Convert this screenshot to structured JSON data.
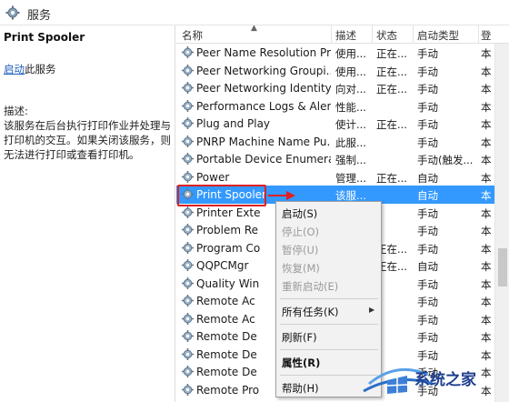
{
  "window": {
    "title": "服务"
  },
  "left": {
    "service_name": "Print Spooler",
    "start_link": "启动",
    "start_rest": "此服务",
    "desc_label": "描述:",
    "desc_text": "该服务在后台执行打印作业并处理与打印机的交互。如果关闭该服务，则无法进行打印或查看打印机。"
  },
  "columns": {
    "name": "名称",
    "desc": "描述",
    "status": "状态",
    "start": "启动类型",
    "logon": "登"
  },
  "services": [
    {
      "name": "Peer Name Resolution Pr...",
      "desc": "使用...",
      "status": "正在...",
      "start": "手动",
      "logon": "本"
    },
    {
      "name": "Peer Networking Groupi...",
      "desc": "使用...",
      "status": "正在...",
      "start": "手动",
      "logon": "本"
    },
    {
      "name": "Peer Networking Identity...",
      "desc": "向对...",
      "status": "正在...",
      "start": "手动",
      "logon": "本"
    },
    {
      "name": "Performance Logs & Aler...",
      "desc": "性能...",
      "status": "",
      "start": "手动",
      "logon": "本"
    },
    {
      "name": "Plug and Play",
      "desc": "使计...",
      "status": "正在...",
      "start": "手动",
      "logon": "本"
    },
    {
      "name": "PNRP Machine Name Pu...",
      "desc": "此服...",
      "status": "",
      "start": "手动",
      "logon": "本"
    },
    {
      "name": "Portable Device Enumera...",
      "desc": "强制...",
      "status": "",
      "start": "手动(触发...",
      "logon": "本"
    },
    {
      "name": "Power",
      "desc": "管理...",
      "status": "正在...",
      "start": "自动",
      "logon": "本"
    },
    {
      "name": "Print Spooler",
      "desc": "该服...",
      "status": "",
      "start": "自动",
      "logon": "本"
    },
    {
      "name": "Printer Exte",
      "desc": "",
      "status": "",
      "start": "手动",
      "logon": "本"
    },
    {
      "name": "Problem Re",
      "desc": "",
      "status": "",
      "start": "手动",
      "logon": "本"
    },
    {
      "name": "Program Co",
      "desc": "",
      "status": "正在...",
      "start": "手动",
      "logon": "本"
    },
    {
      "name": "QQPCMgr",
      "desc": "",
      "status": "正在...",
      "start": "自动",
      "logon": "本"
    },
    {
      "name": "Quality Win",
      "desc": "",
      "status": "",
      "start": "手动",
      "logon": "本"
    },
    {
      "name": "Remote Ac",
      "desc": "",
      "status": "",
      "start": "手动",
      "logon": "本"
    },
    {
      "name": "Remote Ac",
      "desc": "",
      "status": "",
      "start": "手动",
      "logon": "本"
    },
    {
      "name": "Remote De",
      "desc": "",
      "status": "",
      "start": "手动",
      "logon": "本"
    },
    {
      "name": "Remote De",
      "desc": "",
      "status": "",
      "start": "手动",
      "logon": "本"
    },
    {
      "name": "Remote De",
      "desc": "",
      "status": "",
      "start": "手动",
      "logon": "本"
    },
    {
      "name": "Remote Pro",
      "desc": "",
      "status": "",
      "start": "手动",
      "logon": "本"
    }
  ],
  "selected_service": "Print Spooler",
  "context_menu": {
    "start": "启动(S)",
    "stop": "停止(O)",
    "pause": "暂停(U)",
    "resume": "恢复(M)",
    "restart": "重新启动(E)",
    "all_tasks": "所有任务(K)",
    "refresh": "刷新(F)",
    "properties": "属性(R)",
    "help": "帮助(H)"
  },
  "watermark": {
    "text": "系统之家"
  },
  "colors": {
    "selection": "#3399ff",
    "annotation": "#e02020",
    "link": "#1f5fbf"
  }
}
